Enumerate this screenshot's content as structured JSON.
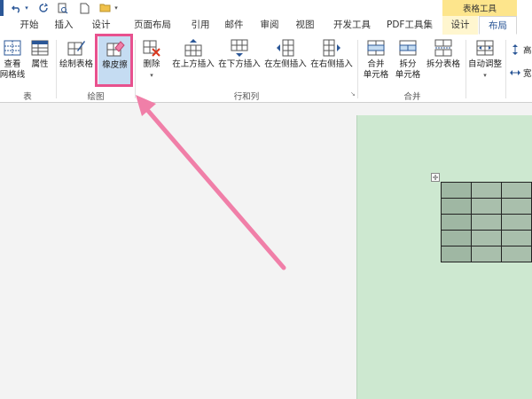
{
  "contextual_tab_group": "表格工具",
  "tabs": [
    {
      "label": "开始"
    },
    {
      "label": "插入"
    },
    {
      "label": "设计"
    },
    {
      "label": "页面布局"
    },
    {
      "label": "引用"
    },
    {
      "label": "邮件"
    },
    {
      "label": "审阅"
    },
    {
      "label": "视图"
    },
    {
      "label": "开发工具"
    },
    {
      "label": "PDF工具集"
    },
    {
      "label": "设计"
    },
    {
      "label": "布局"
    }
  ],
  "ribbon": {
    "view_gridlines": {
      "line1": "查看",
      "line2": "网格线"
    },
    "properties": "属性",
    "draw_table": "绘制表格",
    "eraser": "橡皮擦",
    "delete": "删除",
    "insert_above": "在上方插入",
    "insert_below": "在下方插入",
    "insert_left": "在左侧插入",
    "insert_right": "在右侧插入",
    "merge_cells": {
      "line1": "合并",
      "line2": "单元格"
    },
    "split_cells": {
      "line1": "拆分",
      "line2": "单元格"
    },
    "split_table": "拆分表格",
    "autofit": "自动调整",
    "height": "高",
    "width": "宽",
    "groups": {
      "table": "表",
      "draw": "绘图",
      "rows_cols": "行和列",
      "merge": "合并"
    }
  },
  "document_table": {
    "rows": 5,
    "cols": 3
  },
  "colors": {
    "accent": "#2b5797",
    "context_tab": "#fde58c",
    "highlight": "#e8518e",
    "page_bg": "#cde8d0"
  }
}
